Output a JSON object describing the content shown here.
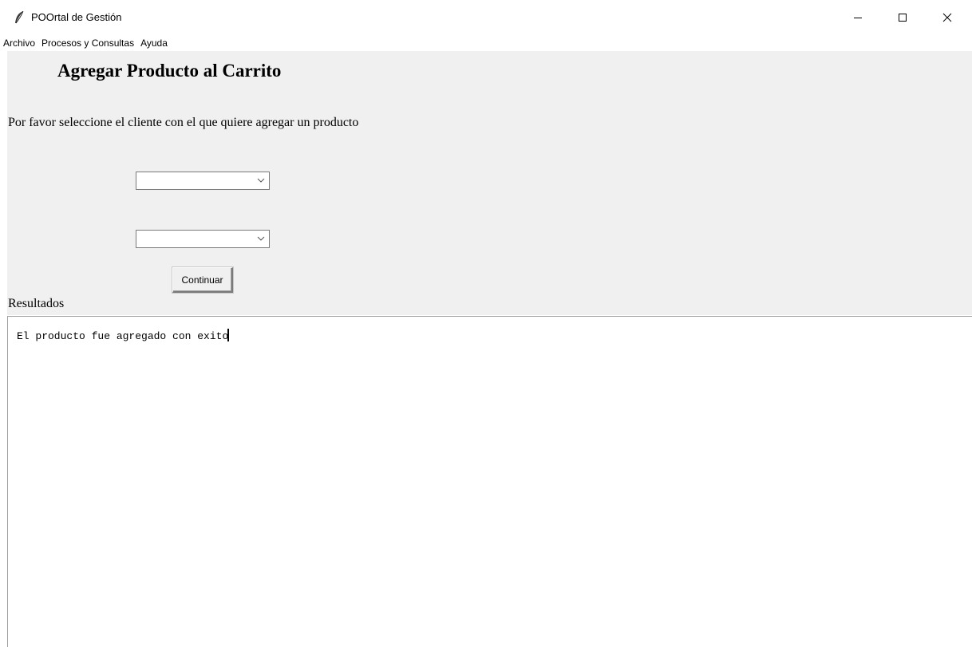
{
  "window": {
    "title": "POOrtal de Gestión",
    "controls": {
      "minimize_icon": "minimize-icon",
      "maximize_icon": "maximize-icon",
      "close_icon": "close-icon"
    }
  },
  "menu": {
    "items": [
      "Archivo",
      "Procesos y Consultas",
      "Ayuda"
    ]
  },
  "form": {
    "heading": "Agregar Producto al Carrito",
    "instruction": "Por favor seleccione el cliente con el que quiere agregar un producto",
    "combo1": {
      "value": ""
    },
    "combo2": {
      "value": ""
    },
    "continue_label": "Continuar"
  },
  "results": {
    "label": "Resultados",
    "text": "El producto fue agregado con exito"
  },
  "colors": {
    "frame_background": "#f0f0f0",
    "window_background": "#ffffff"
  }
}
